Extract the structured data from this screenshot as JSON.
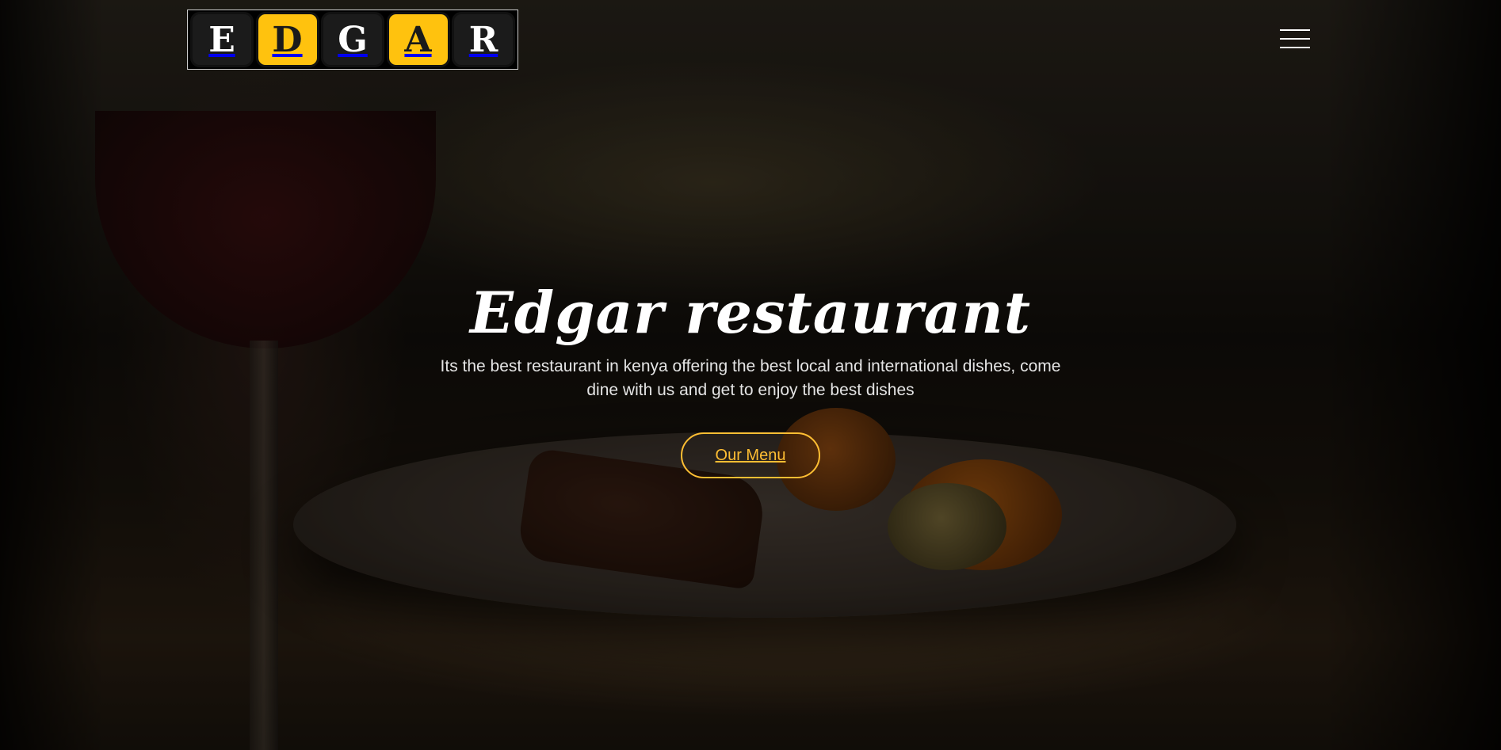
{
  "header": {
    "logo": {
      "letters": [
        "E",
        "D",
        "G",
        "A",
        "R"
      ]
    },
    "menu_toggle": {
      "icon": "hamburger-menu-icon"
    }
  },
  "hero": {
    "title": "Edgar restaurant",
    "text": "Its the best restaurant in kenya offering the best local and international dishes, come dine with us and get to enjoy the best dishes",
    "button_label": "Our Menu"
  },
  "colors": {
    "accent": "#ffbe33",
    "logo_yellow": "#ffc20e",
    "logo_dark": "#1b1b1b"
  }
}
